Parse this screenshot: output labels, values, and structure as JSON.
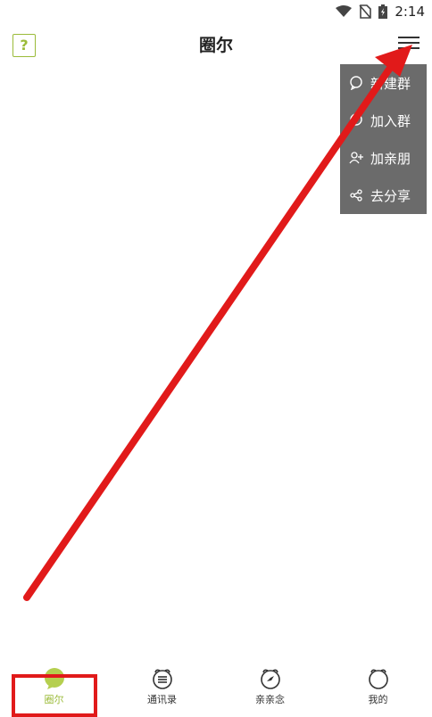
{
  "status": {
    "time": "2:14"
  },
  "header": {
    "title": "圈尔",
    "help_label": "?"
  },
  "menu": {
    "items": [
      {
        "label": "新建群",
        "icon": "chat-bubble-icon"
      },
      {
        "label": "加入群",
        "icon": "chat-bubble-icon"
      },
      {
        "label": "加亲朋",
        "icon": "add-user-icon"
      },
      {
        "label": "去分享",
        "icon": "share-icon"
      }
    ]
  },
  "tabbar": {
    "items": [
      {
        "label": "圈尔",
        "active": true
      },
      {
        "label": "通讯录",
        "active": false
      },
      {
        "label": "亲亲念",
        "active": false
      },
      {
        "label": "我的",
        "active": false
      }
    ]
  },
  "colors": {
    "accent": "#9bbb39",
    "menu_bg": "#6b6b6b",
    "annotation": "#e11a1a"
  }
}
